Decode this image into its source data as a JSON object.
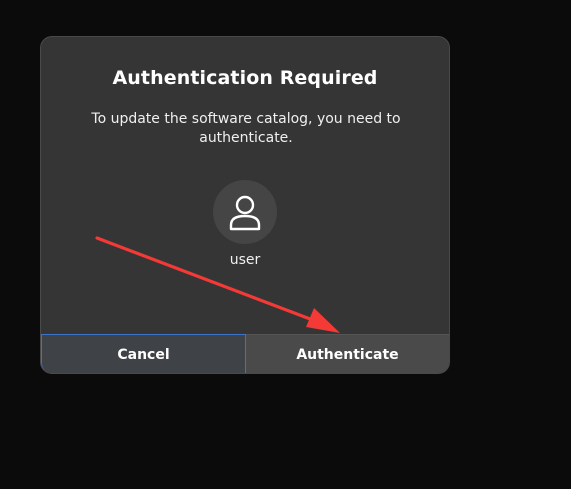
{
  "dialog": {
    "title": "Authentication Required",
    "message": "To update the software catalog, you need to authenticate.",
    "user": {
      "icon": "user-icon",
      "name": "user"
    },
    "buttons": {
      "cancel_label": "Cancel",
      "authenticate_label": "Authenticate"
    }
  },
  "annotation": {
    "icon": "red-arrow",
    "color": "#f43a36"
  },
  "colors": {
    "background": "#0b0b0c",
    "dialog": "#353535",
    "focus_border": "#3d72c9"
  }
}
